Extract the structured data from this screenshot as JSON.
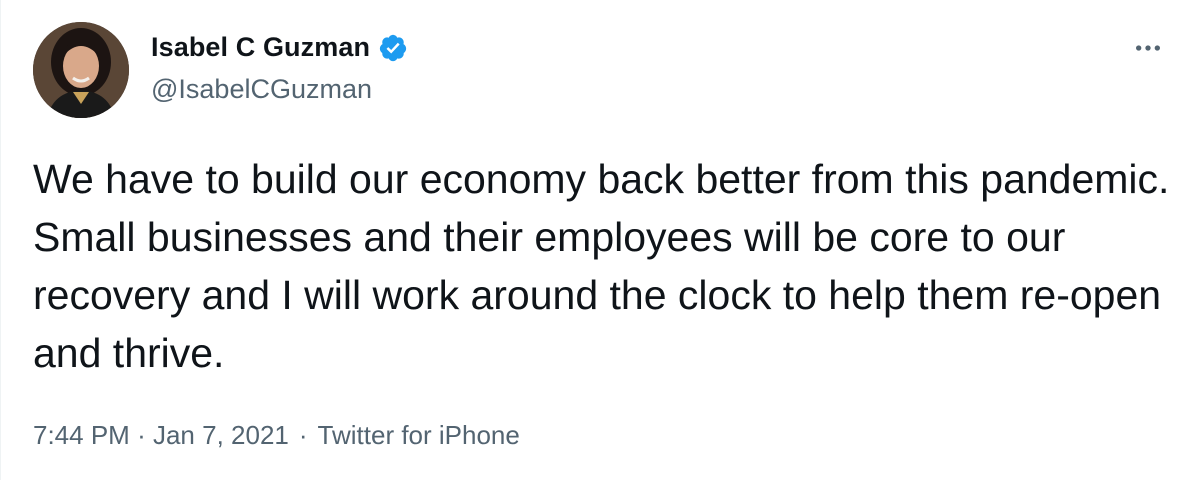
{
  "author": {
    "display_name": "Isabel C Guzman",
    "handle": "@IsabelCGuzman",
    "verified": true
  },
  "tweet": {
    "text": "We have to build our economy back better from this pandemic. Small businesses and their employees will be core to our recovery and I will work around the clock to help them re-open and thrive.",
    "time": "7:44 PM",
    "date": "Jan 7, 2021",
    "source": "Twitter for iPhone",
    "separator": "·"
  },
  "icons": {
    "verified": "verified-badge-icon",
    "more": "more-options-icon"
  },
  "colors": {
    "verified_blue": "#1d9bf0",
    "secondary_text": "#536471",
    "primary_text": "#0f1419"
  }
}
